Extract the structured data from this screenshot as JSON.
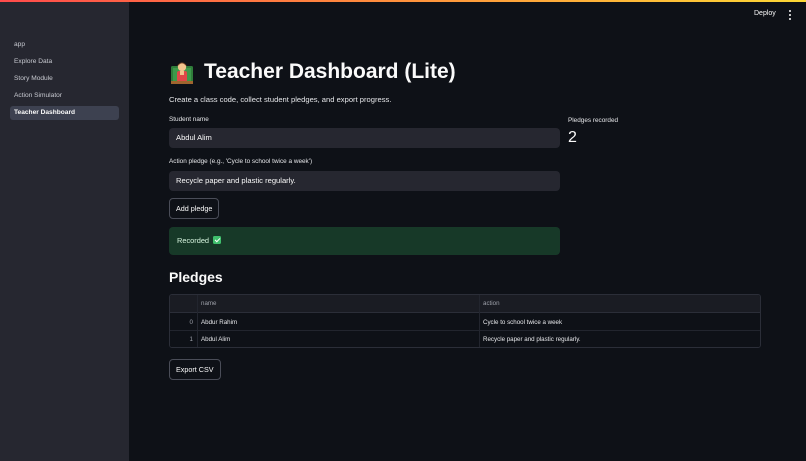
{
  "sidebar": {
    "items": [
      {
        "label": "app"
      },
      {
        "label": "Explore Data"
      },
      {
        "label": "Story Module"
      },
      {
        "label": "Action Simulator"
      },
      {
        "label": "Teacher Dashboard",
        "active": true
      }
    ]
  },
  "topbar": {
    "deploy_label": "Deploy",
    "menu_icon": "kebab-menu-icon"
  },
  "header": {
    "emoji_icon": "teacher-icon",
    "title": "Teacher Dashboard (Lite)",
    "subtitle": "Create a class code, collect student pledges, and export progress."
  },
  "form": {
    "student_name_label": "Student name",
    "student_name_value": "Abdul Alim",
    "pledge_label": "Action pledge (e.g., 'Cycle to school twice a week')",
    "pledge_value": "Recycle paper and plastic regularly.",
    "add_button": "Add pledge"
  },
  "status": {
    "message": "Recorded",
    "icon": "check-icon",
    "color": "#173928"
  },
  "metric": {
    "label": "Pledges recorded",
    "value": "2"
  },
  "pledges": {
    "title": "Pledges",
    "columns": [
      "name",
      "action"
    ],
    "rows": [
      {
        "index": "0",
        "name": "Abdur Rahim",
        "action": "Cycle to school twice a week"
      },
      {
        "index": "1",
        "name": "Abdul Alim",
        "action": "Recycle paper and plastic regularly."
      }
    ]
  },
  "export_button": "Export CSV",
  "colors": {
    "background": "#0e1117",
    "sidebar": "#262730",
    "success": "#173928",
    "accent": "#ff4b4b"
  }
}
